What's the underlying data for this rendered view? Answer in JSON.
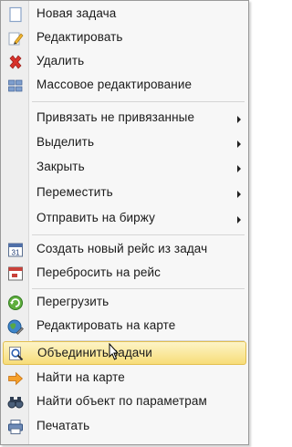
{
  "menu": {
    "items": [
      {
        "label": "Новая задача",
        "icon": "new-task-icon"
      },
      {
        "label": "Редактировать",
        "icon": "edit-pencil-icon"
      },
      {
        "label": "Удалить",
        "icon": "delete-x-icon"
      },
      {
        "label": "Массовое редактирование",
        "icon": "bulk-edit-icon"
      },
      {
        "label": "Привязать не привязанные",
        "submenu": true
      },
      {
        "label": "Выделить",
        "submenu": true
      },
      {
        "label": "Закрыть",
        "submenu": true
      },
      {
        "label": "Переместить",
        "submenu": true
      },
      {
        "label": "Отправить на биржу",
        "submenu": true
      },
      {
        "label": "Создать новый рейс из задач",
        "icon": "calendar-31-icon",
        "icon_text": "31"
      },
      {
        "label": "Перебросить на рейс",
        "icon": "calendar-move-icon"
      },
      {
        "label": "Перегрузить",
        "icon": "reload-icon"
      },
      {
        "label": "Редактировать на карте",
        "icon": "map-edit-icon"
      },
      {
        "label": "Объединить задачи",
        "icon": "merge-tasks-icon",
        "highlighted": true
      },
      {
        "label": "Найти на карте",
        "icon": "arrow-right-icon"
      },
      {
        "label": "Найти объект по параметрам",
        "icon": "binoculars-icon"
      },
      {
        "label": "Печатать",
        "icon": "printer-icon"
      }
    ]
  },
  "colors": {
    "highlight_top": "#fdf4c7",
    "highlight_bottom": "#f7dd79",
    "highlight_border": "#e3bf4f"
  }
}
